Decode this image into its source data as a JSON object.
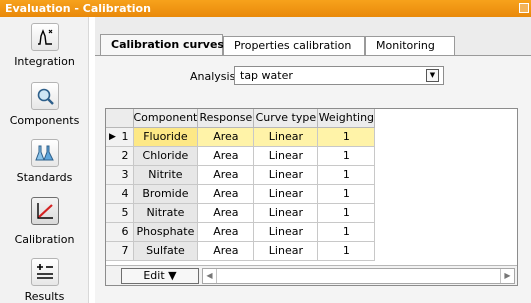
{
  "window": {
    "title": "Evaluation - Calibration"
  },
  "nav": {
    "items": [
      {
        "label": "Integration",
        "icon": "integration-icon"
      },
      {
        "label": "Components",
        "icon": "magnifier-icon"
      },
      {
        "label": "Standards",
        "icon": "flasks-icon"
      },
      {
        "label": "Calibration",
        "icon": "calibration-curve-icon",
        "active": true
      },
      {
        "label": "Results",
        "icon": "results-icon"
      }
    ]
  },
  "tabs": [
    {
      "label": "Calibration curves",
      "active": true
    },
    {
      "label": "Properties calibration"
    },
    {
      "label": "Monitoring"
    }
  ],
  "analysis": {
    "label": "Analysis",
    "value": "tap water"
  },
  "table": {
    "columns": [
      "Component",
      "Response",
      "Curve type",
      "Weighting"
    ],
    "rows": [
      {
        "index": "1",
        "component": "Fluoride",
        "response": "Area",
        "curve_type": "Linear",
        "weighting": "1",
        "selected": true
      },
      {
        "index": "2",
        "component": "Chloride",
        "response": "Area",
        "curve_type": "Linear",
        "weighting": "1"
      },
      {
        "index": "3",
        "component": "Nitrite",
        "response": "Area",
        "curve_type": "Linear",
        "weighting": "1"
      },
      {
        "index": "4",
        "component": "Bromide",
        "response": "Area",
        "curve_type": "Linear",
        "weighting": "1"
      },
      {
        "index": "5",
        "component": "Nitrate",
        "response": "Area",
        "curve_type": "Linear",
        "weighting": "1"
      },
      {
        "index": "6",
        "component": "Phosphate",
        "response": "Area",
        "curve_type": "Linear",
        "weighting": "1"
      },
      {
        "index": "7",
        "component": "Sulfate",
        "response": "Area",
        "curve_type": "Linear",
        "weighting": "1"
      }
    ]
  },
  "edit_button": {
    "label": "Edit ▼"
  },
  "colors": {
    "titlebar": "#f0961a",
    "selected_row": "#fff3a8",
    "selected_key": "#fde886"
  }
}
